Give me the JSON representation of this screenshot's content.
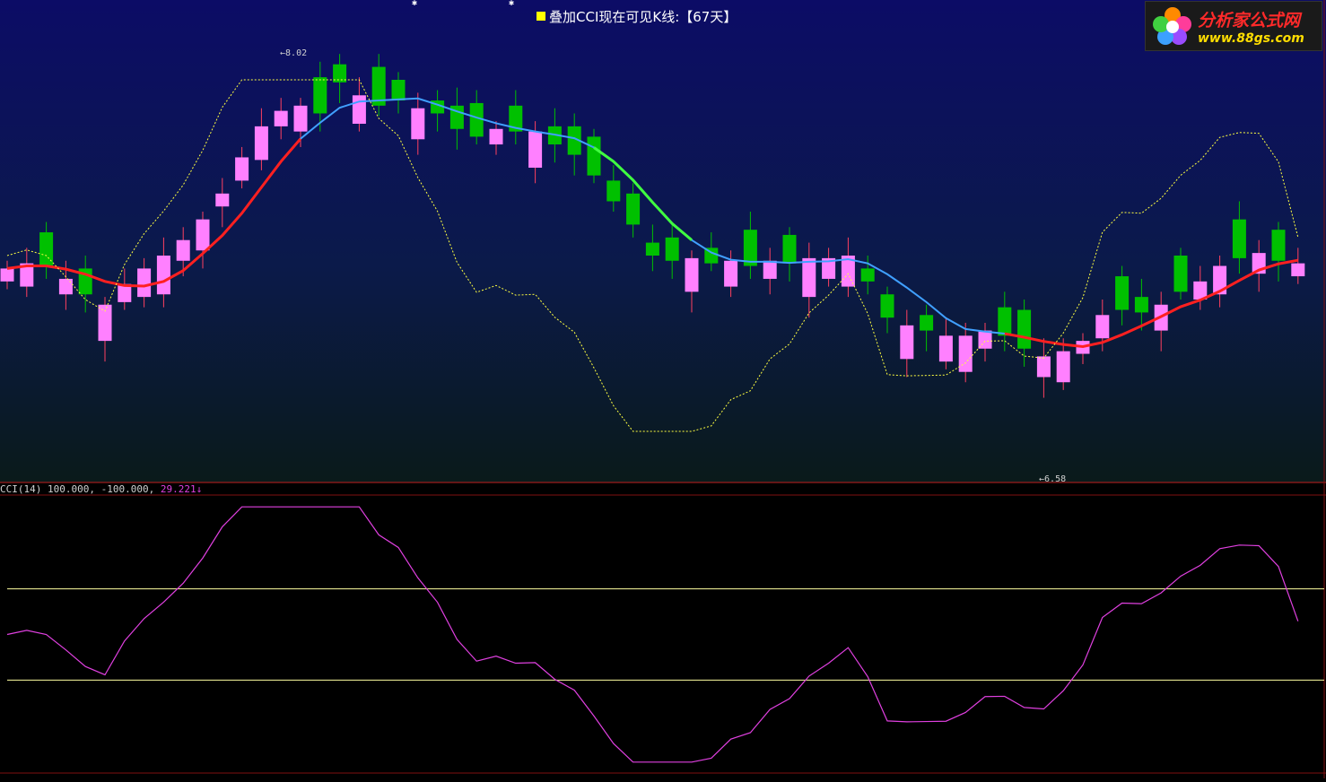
{
  "title": {
    "text": "叠加CCI现在可见K线:【67天】"
  },
  "indicator": {
    "name": "CCI(14)",
    "level_upper": "100.000,",
    "level_lower": "-100.000,",
    "current": "29.221",
    "arrow": "↓"
  },
  "annotations": {
    "high_label": "8.02",
    "low_label": "6.58"
  },
  "logo": {
    "line1": "分析家公式网",
    "line2": "www.88gs.com",
    "icon": "flower-logo-icon"
  },
  "colors": {
    "up_candle": "#ff80ff",
    "down_candle": "#00c000",
    "ma_line": "#40a0ff",
    "red_line": "#ff2020",
    "green_line": "#40ff40",
    "cci_dotted": "#ffff40",
    "cci_line": "#e040e0",
    "ref_line": "#ffffa0"
  },
  "chart_data": [
    {
      "type": "candlestick",
      "high_marker": 8.02,
      "low_marker": 6.58,
      "candles": [
        {
          "dir": "up"
        },
        {
          "dir": "up"
        },
        {
          "dir": "down"
        },
        {
          "dir": "up"
        },
        {
          "dir": "down"
        },
        {
          "dir": "up"
        },
        {
          "dir": "up"
        },
        {
          "dir": "up"
        },
        {
          "dir": "up"
        },
        {
          "dir": "up"
        },
        {
          "dir": "up"
        },
        {
          "dir": "up"
        },
        {
          "dir": "up"
        },
        {
          "dir": "up"
        },
        {
          "dir": "up"
        },
        {
          "dir": "up"
        },
        {
          "dir": "down"
        },
        {
          "dir": "down"
        },
        {
          "dir": "up"
        },
        {
          "dir": "down"
        },
        {
          "dir": "down"
        },
        {
          "dir": "up"
        },
        {
          "dir": "down"
        },
        {
          "dir": "down"
        },
        {
          "dir": "down"
        },
        {
          "dir": "up"
        },
        {
          "dir": "down"
        },
        {
          "dir": "up"
        },
        {
          "dir": "down"
        },
        {
          "dir": "down"
        },
        {
          "dir": "down"
        },
        {
          "dir": "down"
        },
        {
          "dir": "down"
        },
        {
          "dir": "down"
        },
        {
          "dir": "down"
        },
        {
          "dir": "up"
        },
        {
          "dir": "down"
        },
        {
          "dir": "up"
        },
        {
          "dir": "down"
        },
        {
          "dir": "up"
        },
        {
          "dir": "down"
        },
        {
          "dir": "up"
        },
        {
          "dir": "up"
        },
        {
          "dir": "up"
        },
        {
          "dir": "down"
        },
        {
          "dir": "down"
        },
        {
          "dir": "up"
        },
        {
          "dir": "down"
        },
        {
          "dir": "up"
        },
        {
          "dir": "up"
        },
        {
          "dir": "up"
        },
        {
          "dir": "down"
        },
        {
          "dir": "down"
        },
        {
          "dir": "up"
        },
        {
          "dir": "up"
        },
        {
          "dir": "up"
        },
        {
          "dir": "up"
        },
        {
          "dir": "down"
        },
        {
          "dir": "down"
        },
        {
          "dir": "up"
        },
        {
          "dir": "down"
        },
        {
          "dir": "up"
        },
        {
          "dir": "up"
        },
        {
          "dir": "down"
        },
        {
          "dir": "up"
        },
        {
          "dir": "down"
        },
        {
          "dir": "up"
        }
      ]
    },
    {
      "type": "line",
      "name": "CCI(14)",
      "reference_levels": [
        100,
        -100
      ],
      "current_value": 29.221
    }
  ]
}
